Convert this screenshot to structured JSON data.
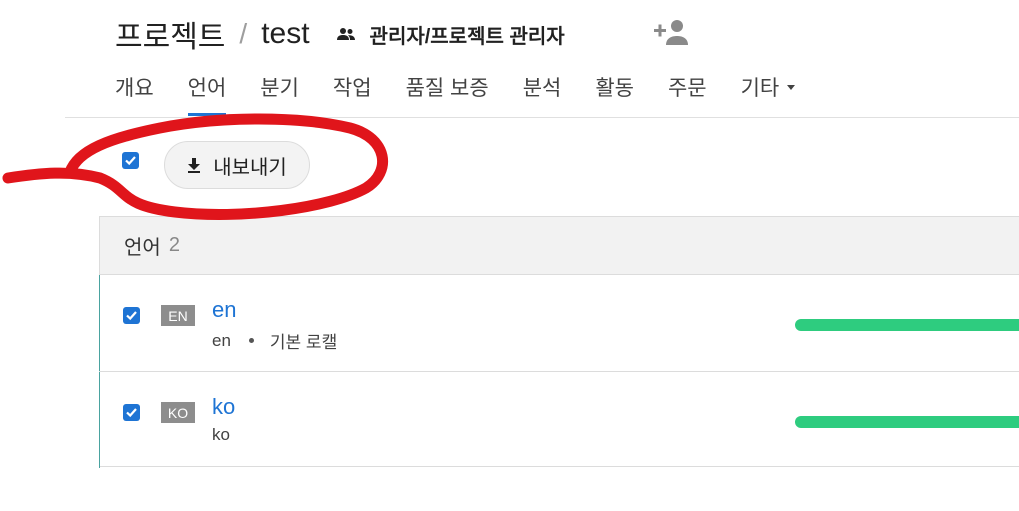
{
  "header": {
    "project_label": "프로젝트",
    "separator": "/",
    "project_name": "test",
    "role": "관리자/프로젝트 관리자",
    "add_user_icon": "person-add-icon",
    "role_icon": "group-icon"
  },
  "tabs": [
    {
      "label": "개요",
      "active": false
    },
    {
      "label": "언어",
      "active": true
    },
    {
      "label": "분기",
      "active": false
    },
    {
      "label": "작업",
      "active": false
    },
    {
      "label": "품질 보증",
      "active": false
    },
    {
      "label": "분석",
      "active": false
    },
    {
      "label": "활동",
      "active": false
    },
    {
      "label": "주문",
      "active": false
    },
    {
      "label": "기타",
      "active": false,
      "dropdown": true
    }
  ],
  "toolbar": {
    "select_all_checked": true,
    "export_label": "내보내기",
    "export_icon": "download-icon"
  },
  "languages": {
    "title": "언어",
    "count": "2",
    "items": [
      {
        "badge": "EN",
        "name": "en",
        "code": "en",
        "note": "기본 로캘",
        "checked": true,
        "progress": 1.0
      },
      {
        "badge": "KO",
        "name": "ko",
        "code": "ko",
        "note": "",
        "checked": true,
        "progress": 1.0
      }
    ]
  },
  "colors": {
    "accent": "#1e74d4",
    "progress": "#2ecc7f",
    "annotation": "#e0151b",
    "badge": "#8d8d8d"
  }
}
